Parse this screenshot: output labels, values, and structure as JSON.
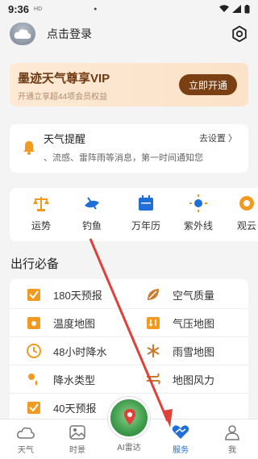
{
  "status_bar": {
    "time": "9:36",
    "small_text": "HD",
    "signal_label": ""
  },
  "header": {
    "login_label": "点击登录"
  },
  "vip": {
    "title": "墨迹天气尊享VIP",
    "subtitle": "开通立享超44项会员权益",
    "button": "立即开通"
  },
  "alert": {
    "title": "天气提醒",
    "setting": "去设置 〉",
    "description": "、流感、雷阵雨等消息，第一时间通知您"
  },
  "quick": [
    {
      "label": "运势",
      "icon": "scale-icon"
    },
    {
      "label": "钓鱼",
      "icon": "fishing-icon"
    },
    {
      "label": "万年历",
      "icon": "calendar-icon"
    },
    {
      "label": "紫外线",
      "icon": "sun-icon"
    },
    {
      "label": "观云",
      "icon": "cloud-watch-icon"
    }
  ],
  "section": {
    "title": "出行必备"
  },
  "grid": [
    {
      "label": "180天预报",
      "icon": "forecast-180-icon"
    },
    {
      "label": "空气质量",
      "icon": "air-quality-icon"
    },
    {
      "label": "温度地图",
      "icon": "temperature-map-icon"
    },
    {
      "label": "气压地图",
      "icon": "pressure-map-icon"
    },
    {
      "label": "48小时降水",
      "icon": "precip-48h-icon"
    },
    {
      "label": "雨雪地图",
      "icon": "rain-snow-map-icon"
    },
    {
      "label": "降水类型",
      "icon": "precip-type-icon"
    },
    {
      "label": "地图风力",
      "icon": "wind-map-icon"
    },
    {
      "label": "40天预报",
      "icon": "forecast-40-icon"
    }
  ],
  "tabs": [
    {
      "label": "天气",
      "icon": "cloud-icon"
    },
    {
      "label": "时景",
      "icon": "photo-icon"
    },
    {
      "label": "AI雷达",
      "icon": "radar-icon"
    },
    {
      "label": "服务",
      "icon": "service-icon"
    },
    {
      "label": "我",
      "icon": "profile-icon"
    }
  ],
  "colors": {
    "accent": "#1f6fd6",
    "vip_brown": "#7a3f12",
    "icon_orange": "#f29a1f",
    "arrow_red": "#e0403a"
  }
}
